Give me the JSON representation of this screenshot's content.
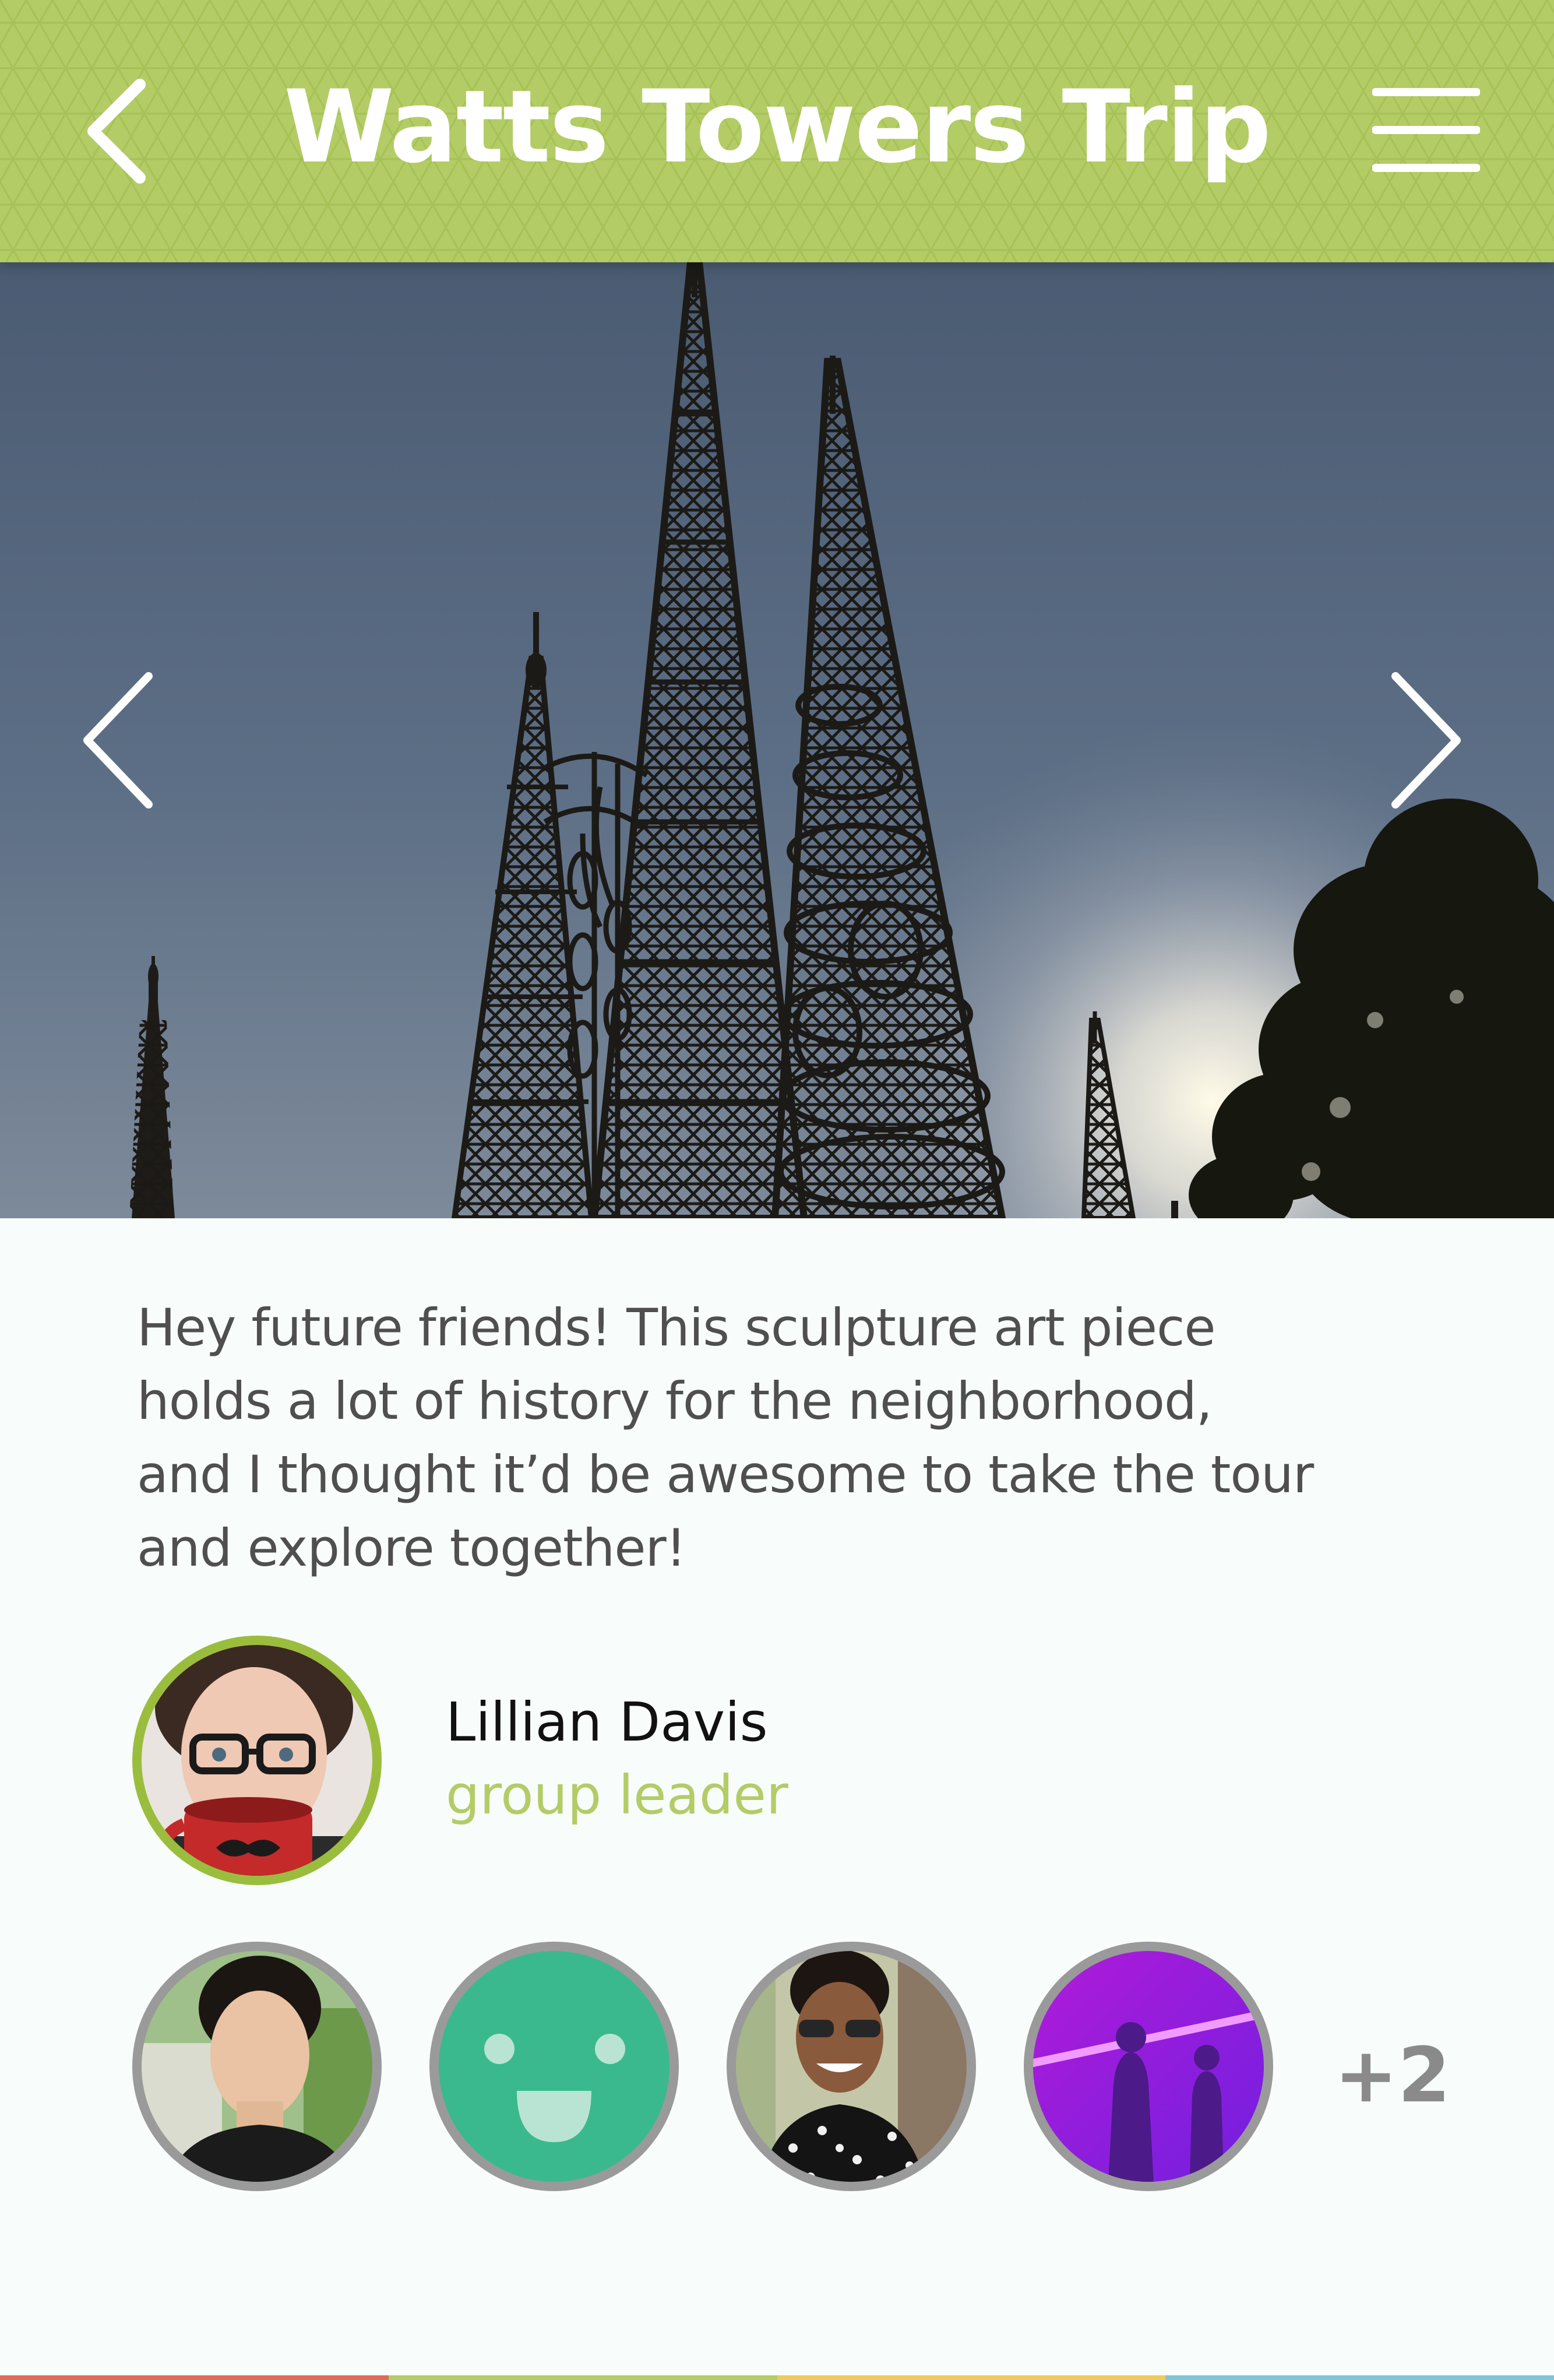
{
  "header": {
    "title": "Watts Towers Trip",
    "back_icon": "chevron-left-icon",
    "menu_icon": "hamburger-menu-icon",
    "background_color": "#b3cc66"
  },
  "hero": {
    "image": "watts-towers-photo",
    "prev_icon": "chevron-left-icon",
    "next_icon": "chevron-right-icon"
  },
  "post": {
    "lines": [
      "Hey future friends! This sculpture art piece",
      "holds a lot of history for the neighborhood,",
      "and I thought it’d be awesome to take the tour",
      "and explore together!"
    ]
  },
  "leader": {
    "name": "Lillian Davis",
    "role": "group leader",
    "ring_color": "#9bbd3d"
  },
  "members": {
    "ring_color": "#9a9a9a",
    "more_count": "+2",
    "items": [
      {
        "name": "member-avatar-1"
      },
      {
        "name": "member-avatar-placeholder"
      },
      {
        "name": "member-avatar-3"
      },
      {
        "name": "member-avatar-4"
      }
    ]
  },
  "colors": {
    "accent": "#b3cc66",
    "placeholder_avatar": "#3bb98e",
    "text": "#4f4f4f"
  }
}
